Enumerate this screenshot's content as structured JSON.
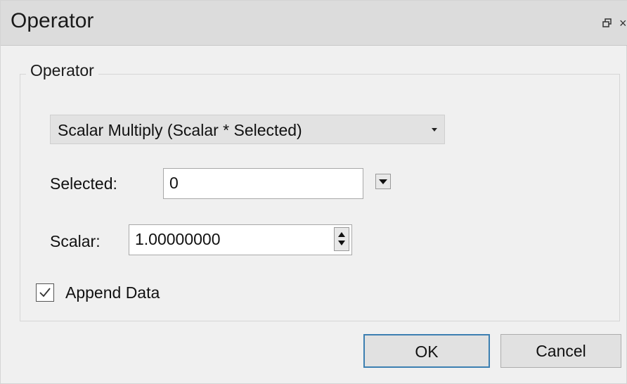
{
  "window": {
    "title": "Operator",
    "close_glyph": "×"
  },
  "group": {
    "label": "Operator"
  },
  "operation_select": {
    "selected_value": "Scalar Multiply (Scalar * Selected)"
  },
  "selected_field": {
    "label": "Selected:",
    "value": "0"
  },
  "scalar_field": {
    "label": "Scalar:",
    "value": "1.00000000"
  },
  "append_data": {
    "label": "Append Data",
    "checked": true
  },
  "buttons": {
    "ok_label": "OK",
    "cancel_label": "Cancel"
  },
  "icons": {
    "restore": "restore-icon",
    "close": "close-icon",
    "dropdown": "chevron-down-icon",
    "spinner": "spinner-arrows-icon",
    "check": "check-icon"
  },
  "colors": {
    "titlebar_bg": "#dcdcdc",
    "window_bg": "#f0f0f0",
    "default_button_border": "#3c7fb1"
  }
}
